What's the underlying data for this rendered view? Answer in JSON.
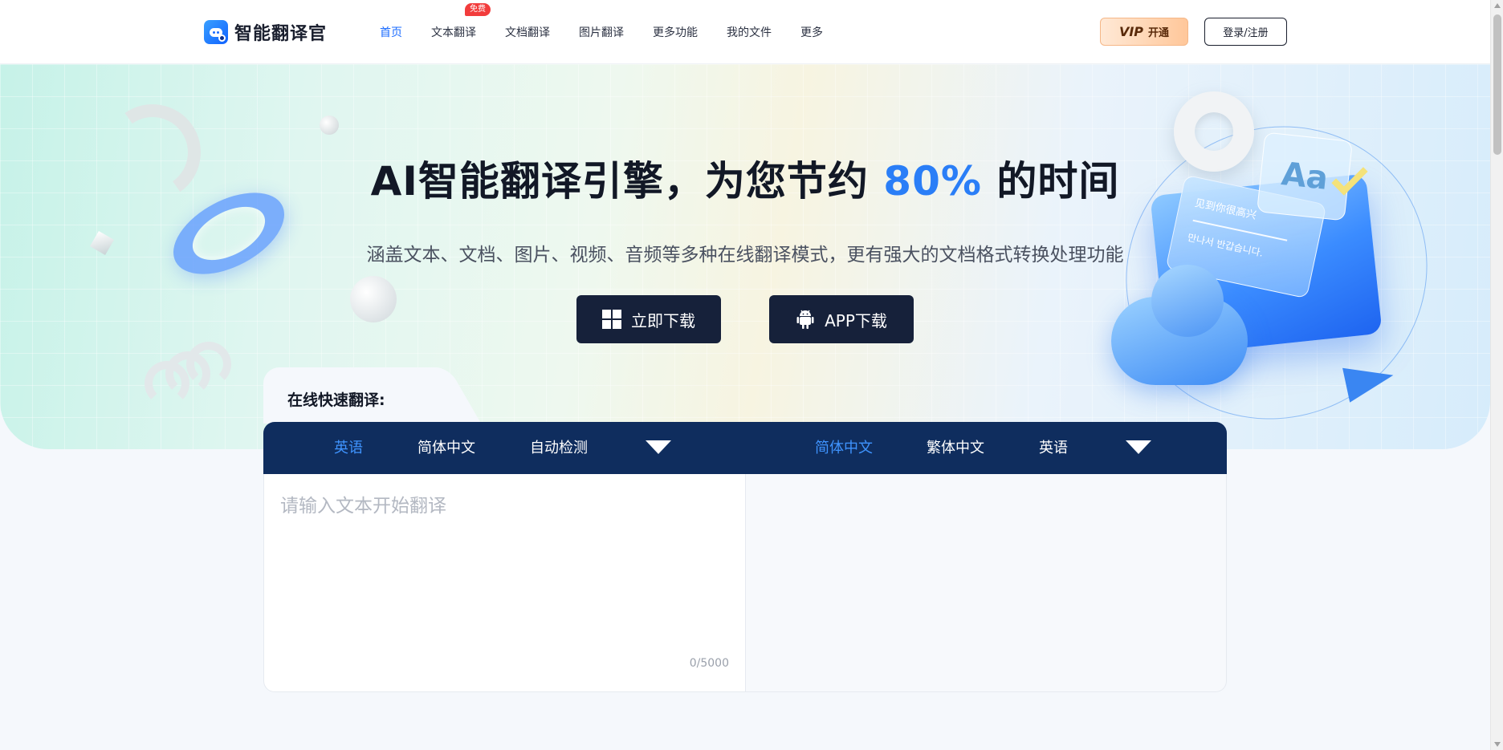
{
  "header": {
    "logo_text": "智能翻译官",
    "nav": [
      {
        "label": "首页",
        "active": true
      },
      {
        "label": "文本翻译",
        "badge": "免费"
      },
      {
        "label": "文档翻译"
      },
      {
        "label": "图片翻译"
      },
      {
        "label": "更多功能"
      },
      {
        "label": "我的文件"
      },
      {
        "label": "更多"
      }
    ],
    "vip_label": "VIP",
    "vip_open_label": "开通",
    "login_label": "登录/注册"
  },
  "hero": {
    "title_prefix": "AI智能翻译引擎，为您节约 ",
    "title_accent": "80%",
    "title_suffix": " 的时间",
    "subtitle": "涵盖文本、文档、图片、视频、音频等多种在线翻译模式，更有强大的文档格式转换处理功能",
    "download_windows_label": "立即下载",
    "download_app_label": "APP下载",
    "card_text_1": "见到你很高兴",
    "card_text_2": "만나서 반갑습니다.",
    "aa_text": "Aa"
  },
  "translator": {
    "section_label": "在线快速翻译:",
    "source_langs": [
      "英语",
      "简体中文",
      "自动检测"
    ],
    "source_selected": "英语",
    "target_langs": [
      "简体中文",
      "繁体中文",
      "英语"
    ],
    "target_selected": "简体中文",
    "input_placeholder": "请输入文本开始翻译",
    "char_count": "0",
    "char_limit": "/5000"
  },
  "colors": {
    "accent": "#2a7ef7",
    "nav_active": "#1a6bff",
    "lang_bar": "#0f2d5e",
    "button_dark": "#16213a",
    "badge_red": "#f23c3c"
  }
}
